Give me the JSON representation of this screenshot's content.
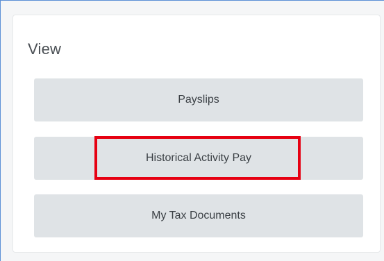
{
  "view_section": {
    "title": "View",
    "buttons": [
      {
        "label": "Payslips"
      },
      {
        "label": "Historical Activity Pay"
      },
      {
        "label": "My Tax Documents"
      }
    ]
  },
  "highlight": {
    "color": "#e60012",
    "target": "Historical Activity Pay"
  }
}
